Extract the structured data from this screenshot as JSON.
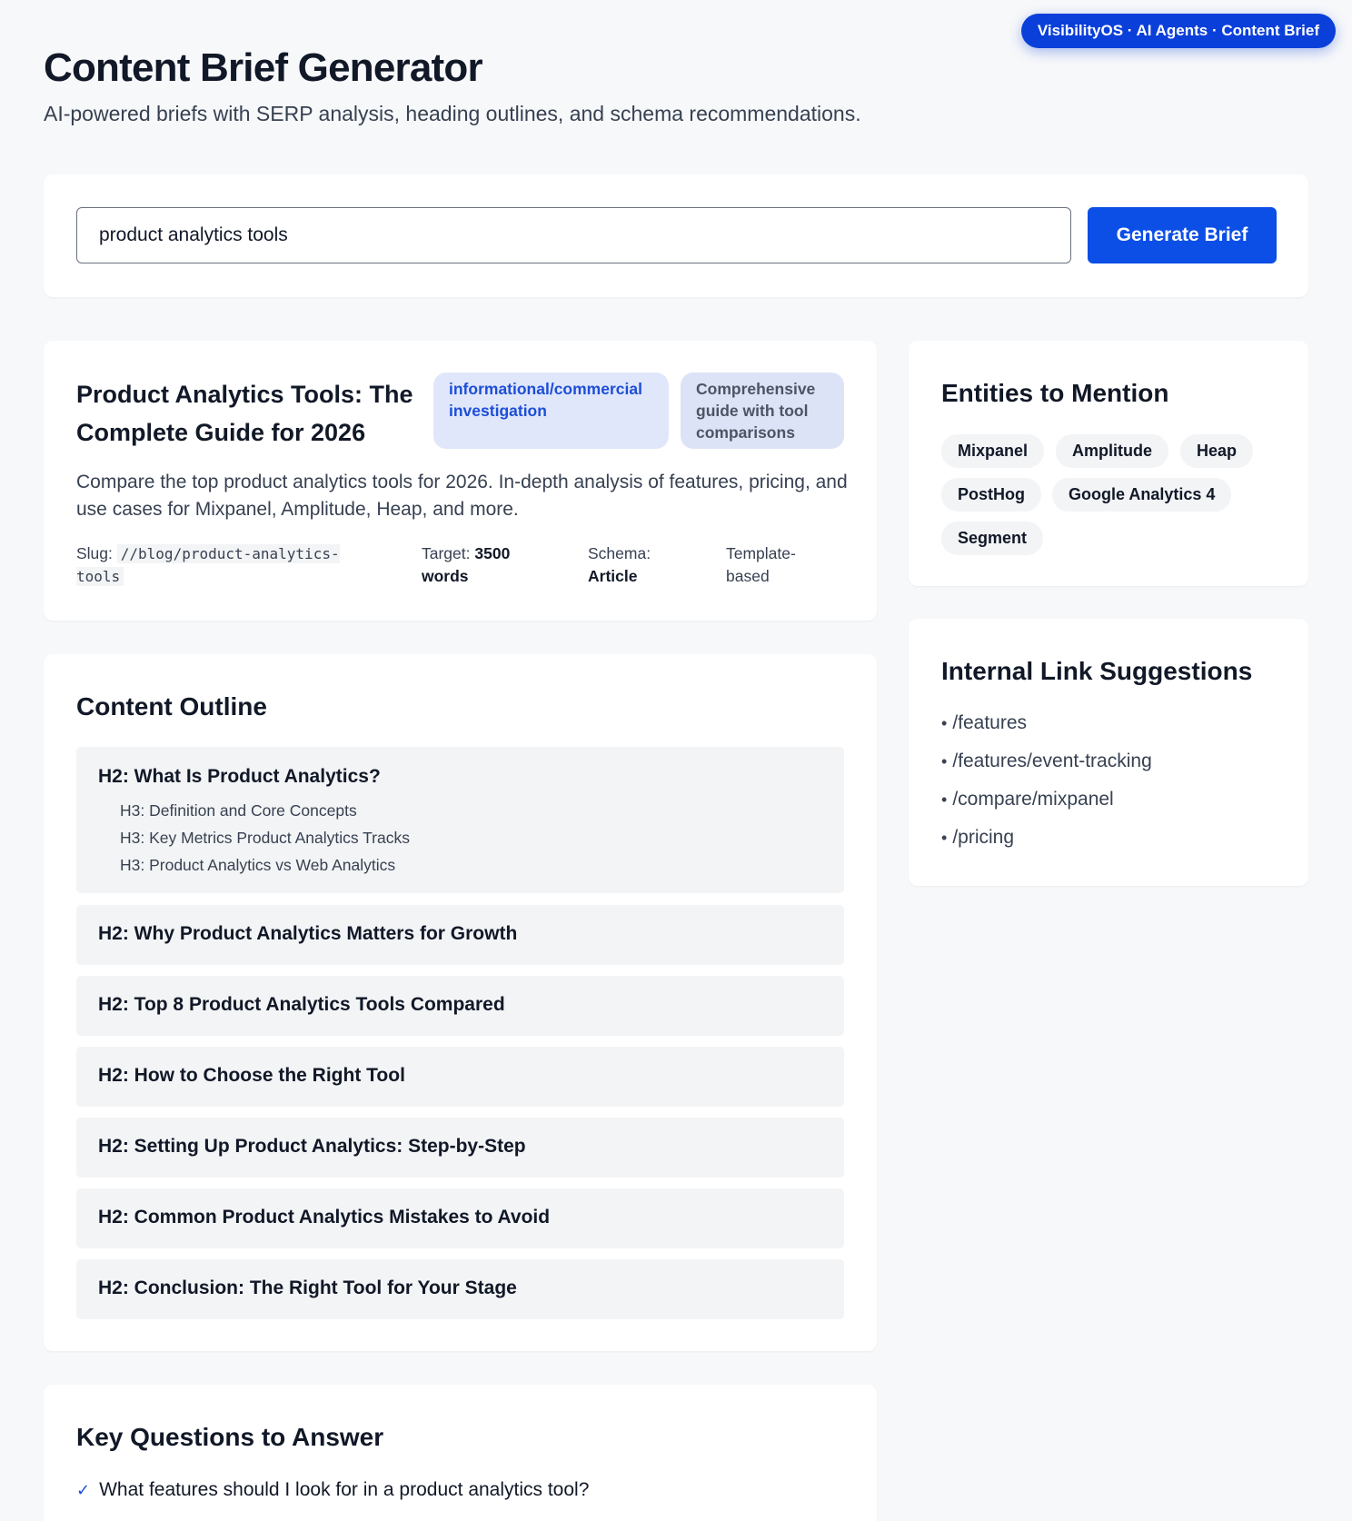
{
  "header": {
    "badge": "VisibilityOS · AI Agents · Content Brief",
    "title": "Content Brief Generator",
    "subtitle": "AI-powered briefs with SERP analysis, heading outlines, and schema recommendations."
  },
  "search": {
    "value": "product analytics tools",
    "button_label": "Generate Brief"
  },
  "brief": {
    "title": "Product Analytics Tools: The Complete Guide for 2026",
    "intent_pill": "informational/commercial investigation",
    "format_pill": "Comprehensive guide with tool comparisons",
    "description": "Compare the top product analytics tools for 2026. In-depth analysis of features, pricing, and use cases for Mixpanel, Amplitude, Heap, and more.",
    "slug_label": "Slug:",
    "slug_value": "//blog/product-analytics-tools",
    "target_label": "Target:",
    "target_value": "3500 words",
    "schema_label": "Schema:",
    "schema_value": "Article",
    "template_label": "Template-based"
  },
  "outline": {
    "title": "Content Outline",
    "sections": [
      {
        "h2": "H2: What Is Product Analytics?",
        "h3": [
          "H3: Definition and Core Concepts",
          "H3: Key Metrics Product Analytics Tracks",
          "H3: Product Analytics vs Web Analytics"
        ]
      },
      {
        "h2": "H2: Why Product Analytics Matters for Growth"
      },
      {
        "h2": "H2: Top 8 Product Analytics Tools Compared"
      },
      {
        "h2": "H2: How to Choose the Right Tool"
      },
      {
        "h2": "H2: Setting Up Product Analytics: Step-by-Step"
      },
      {
        "h2": "H2: Common Product Analytics Mistakes to Avoid"
      },
      {
        "h2": "H2: Conclusion: The Right Tool for Your Stage"
      }
    ]
  },
  "questions": {
    "title": "Key Questions to Answer",
    "items": [
      "What features should I look for in a product analytics tool?"
    ]
  },
  "entities": {
    "title": "Entities to Mention",
    "items": [
      "Mixpanel",
      "Amplitude",
      "Heap",
      "PostHog",
      "Google Analytics 4",
      "Segment"
    ]
  },
  "links": {
    "title": "Internal Link Suggestions",
    "items": [
      "/features",
      "/features/event-tracking",
      "/compare/mixpanel",
      "/pricing"
    ]
  }
}
